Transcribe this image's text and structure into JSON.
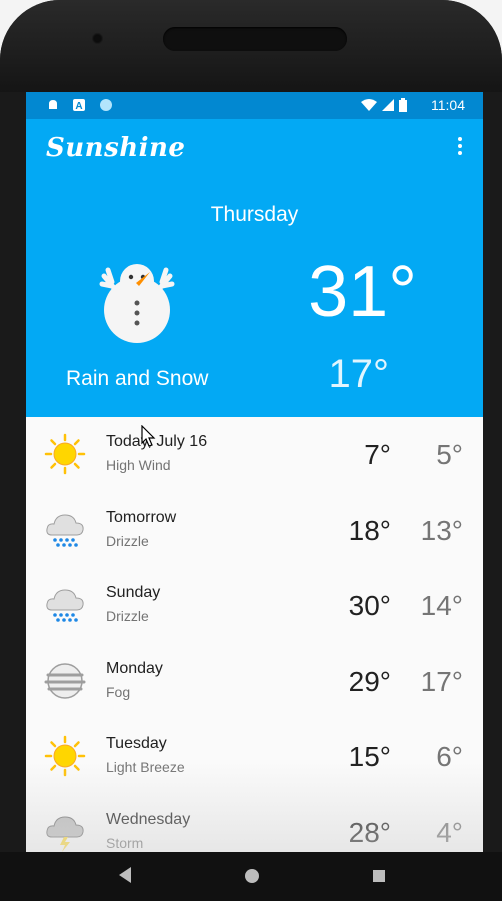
{
  "status_bar": {
    "time": "11:04",
    "icons": [
      "notification-icon",
      "app-a-icon",
      "circle-icon",
      "wifi-icon",
      "signal-icon",
      "battery-icon"
    ],
    "bg_color": "#0288d1"
  },
  "app": {
    "title": "Sunshine",
    "accent_color": "#03a9f4",
    "menu_icon": "overflow-menu-icon"
  },
  "today": {
    "day": "Thursday",
    "condition": "Rain and Snow",
    "high": "31°",
    "low": "17°",
    "icon": "snowman-icon"
  },
  "forecast": [
    {
      "date": "Today, July 16",
      "desc": "High Wind",
      "hi": "7°",
      "lo": "5°",
      "icon": "sun-icon"
    },
    {
      "date": "Tomorrow",
      "desc": "Drizzle",
      "hi": "18°",
      "lo": "13°",
      "icon": "drizzle-icon"
    },
    {
      "date": "Sunday",
      "desc": "Drizzle",
      "hi": "30°",
      "lo": "14°",
      "icon": "drizzle-icon"
    },
    {
      "date": "Monday",
      "desc": "Fog",
      "hi": "29°",
      "lo": "17°",
      "icon": "fog-icon"
    },
    {
      "date": "Tuesday",
      "desc": "Light Breeze",
      "hi": "15°",
      "lo": "6°",
      "icon": "sun-icon"
    },
    {
      "date": "Wednesday",
      "desc": "Storm",
      "hi": "28°",
      "lo": "4°",
      "icon": "storm-icon"
    }
  ],
  "nav": {
    "back": "back-icon",
    "home": "home-icon",
    "recents": "recents-icon"
  }
}
